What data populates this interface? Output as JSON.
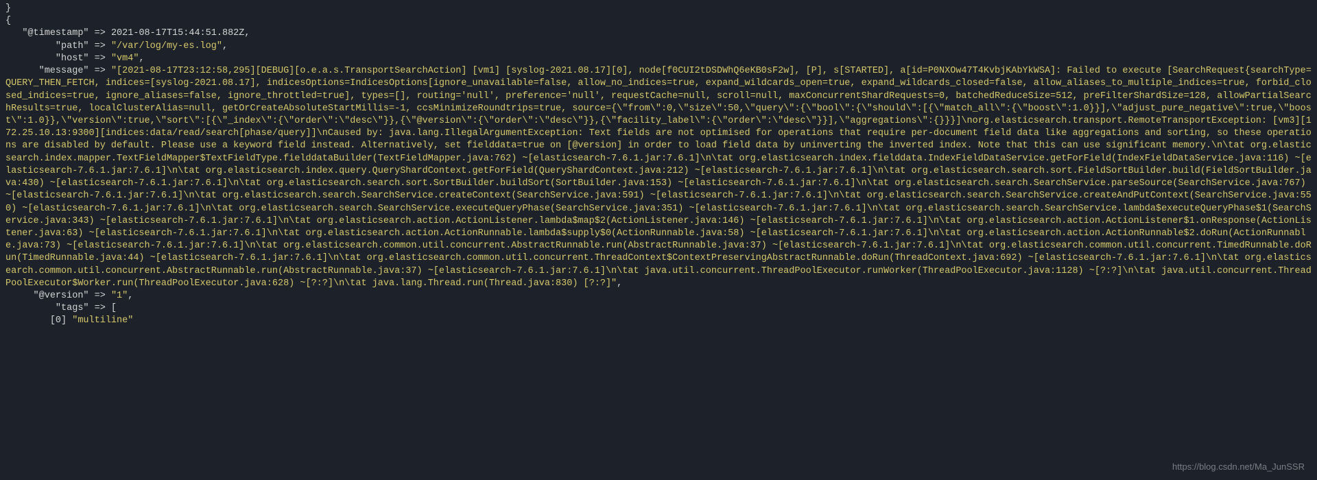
{
  "brace_close": "}",
  "brace_open": "{",
  "timestamp_label": "   \"@timestamp\" => ",
  "timestamp_value": "2021-08-17T15:44:51.882Z,",
  "path_label": "         \"path\" => ",
  "path_value": "\"/var/log/my-es.log\"",
  "comma": ",",
  "host_label": "         \"host\" => ",
  "host_value": "\"vm4\"",
  "message_label": "      \"message\" => ",
  "message_value": "\"[2021-08-17T23:12:58,295][DEBUG][o.e.a.s.TransportSearchAction] [vm1] [syslog-2021.08.17][0], node[f0CUI2tDSDWhQ6eKB0sF2w], [P], s[STARTED], a[id=P0NXOw47T4KvbjKAbYkWSA]: Failed to execute [SearchRequest{searchType=QUERY_THEN_FETCH, indices=[syslog-2021.08.17], indicesOptions=IndicesOptions[ignore_unavailable=false, allow_no_indices=true, expand_wildcards_open=true, expand_wildcards_closed=false, allow_aliases_to_multiple_indices=true, forbid_closed_indices=true, ignore_aliases=false, ignore_throttled=true], types=[], routing='null', preference='null', requestCache=null, scroll=null, maxConcurrentShardRequests=0, batchedReduceSize=512, preFilterShardSize=128, allowPartialSearchResults=true, localClusterAlias=null, getOrCreateAbsoluteStartMillis=-1, ccsMinimizeRoundtrips=true, source={\\\"from\\\":0,\\\"size\\\":50,\\\"query\\\":{\\\"bool\\\":{\\\"should\\\":[{\\\"match_all\\\":{\\\"boost\\\":1.0}}],\\\"adjust_pure_negative\\\":true,\\\"boost\\\":1.0}},\\\"version\\\":true,\\\"sort\\\":[{\\\"_index\\\":{\\\"order\\\":\\\"desc\\\"}},{\\\"@version\\\":{\\\"order\\\":\\\"desc\\\"}},{\\\"facility_label\\\":{\\\"order\\\":\\\"desc\\\"}}],\\\"aggregations\\\":{}}}]\\norg.elasticsearch.transport.RemoteTransportException: [vm3][172.25.10.13:9300][indices:data/read/search[phase/query]]\\nCaused by: java.lang.IllegalArgumentException: Text fields are not optimised for operations that require per-document field data like aggregations and sorting, so these operations are disabled by default. Please use a keyword field instead. Alternatively, set fielddata=true on [@version] in order to load field data by uninverting the inverted index. Note that this can use significant memory.\\n\\tat org.elasticsearch.index.mapper.TextFieldMapper$TextFieldType.fielddataBuilder(TextFieldMapper.java:762) ~[elasticsearch-7.6.1.jar:7.6.1]\\n\\tat org.elasticsearch.index.fielddata.IndexFieldDataService.getForField(IndexFieldDataService.java:116) ~[elasticsearch-7.6.1.jar:7.6.1]\\n\\tat org.elasticsearch.index.query.QueryShardContext.getForField(QueryShardContext.java:212) ~[elasticsearch-7.6.1.jar:7.6.1]\\n\\tat org.elasticsearch.search.sort.FieldSortBuilder.build(FieldSortBuilder.java:430) ~[elasticsearch-7.6.1.jar:7.6.1]\\n\\tat org.elasticsearch.search.sort.SortBuilder.buildSort(SortBuilder.java:153) ~[elasticsearch-7.6.1.jar:7.6.1]\\n\\tat org.elasticsearch.search.SearchService.parseSource(SearchService.java:767) ~[elasticsearch-7.6.1.jar:7.6.1]\\n\\tat org.elasticsearch.search.SearchService.createContext(SearchService.java:591) ~[elasticsearch-7.6.1.jar:7.6.1]\\n\\tat org.elasticsearch.search.SearchService.createAndPutContext(SearchService.java:550) ~[elasticsearch-7.6.1.jar:7.6.1]\\n\\tat org.elasticsearch.search.SearchService.executeQueryPhase(SearchService.java:351) ~[elasticsearch-7.6.1.jar:7.6.1]\\n\\tat org.elasticsearch.search.SearchService.lambda$executeQueryPhase$1(SearchService.java:343) ~[elasticsearch-7.6.1.jar:7.6.1]\\n\\tat org.elasticsearch.action.ActionListener.lambda$map$2(ActionListener.java:146) ~[elasticsearch-7.6.1.jar:7.6.1]\\n\\tat org.elasticsearch.action.ActionListener$1.onResponse(ActionListener.java:63) ~[elasticsearch-7.6.1.jar:7.6.1]\\n\\tat org.elasticsearch.action.ActionRunnable.lambda$supply$0(ActionRunnable.java:58) ~[elasticsearch-7.6.1.jar:7.6.1]\\n\\tat org.elasticsearch.action.ActionRunnable$2.doRun(ActionRunnable.java:73) ~[elasticsearch-7.6.1.jar:7.6.1]\\n\\tat org.elasticsearch.common.util.concurrent.AbstractRunnable.run(AbstractRunnable.java:37) ~[elasticsearch-7.6.1.jar:7.6.1]\\n\\tat org.elasticsearch.common.util.concurrent.TimedRunnable.doRun(TimedRunnable.java:44) ~[elasticsearch-7.6.1.jar:7.6.1]\\n\\tat org.elasticsearch.common.util.concurrent.ThreadContext$ContextPreservingAbstractRunnable.doRun(ThreadContext.java:692) ~[elasticsearch-7.6.1.jar:7.6.1]\\n\\tat org.elasticsearch.common.util.concurrent.AbstractRunnable.run(AbstractRunnable.java:37) ~[elasticsearch-7.6.1.jar:7.6.1]\\n\\tat java.util.concurrent.ThreadPoolExecutor.runWorker(ThreadPoolExecutor.java:1128) ~[?:?]\\n\\tat java.util.concurrent.ThreadPoolExecutor$Worker.run(ThreadPoolExecutor.java:628) ~[?:?]\\n\\tat java.lang.Thread.run(Thread.java:830) [?:?]\"",
  "version_label": "     \"@version\" => ",
  "version_value": "\"1\"",
  "tags_label": "         \"tags\" => [",
  "tags_index": "        [0] ",
  "tags_value": "\"multiline\"",
  "watermark": "https://blog.csdn.net/Ma_JunSSR"
}
